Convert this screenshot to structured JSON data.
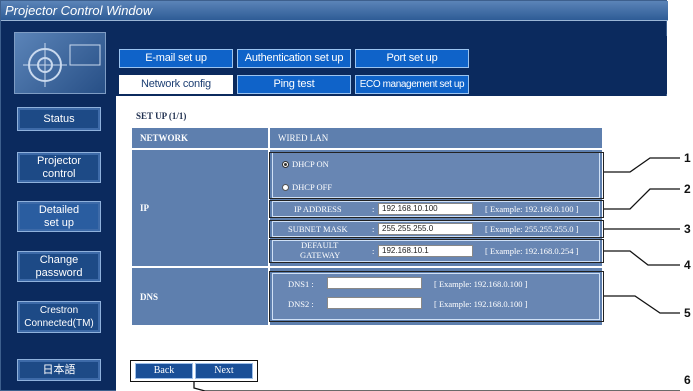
{
  "window": {
    "title": "Projector Control Window"
  },
  "sidebar": {
    "items": [
      {
        "label": "Status"
      },
      {
        "label": "Projector\ncontrol"
      },
      {
        "label": "Detailed\nset up"
      },
      {
        "label": "Change\npassword"
      },
      {
        "label": "Crestron\nConnected(TM)"
      },
      {
        "label": "日本語"
      }
    ]
  },
  "tabs": {
    "row1": [
      "E-mail set up",
      "Authentication set up",
      "Port set up"
    ],
    "row2": [
      "Network config",
      "Ping test",
      "ECO management set up"
    ]
  },
  "page": {
    "setup_title": "SET UP (1/1)"
  },
  "network": {
    "label": "NETWORK",
    "value": "WIRED LAN"
  },
  "ip": {
    "label": "IP",
    "dhcp_on": "DHCP ON",
    "dhcp_off": "DHCP OFF",
    "ip_address_label": "IP ADDRESS",
    "ip_address_value": "192.168.10.100",
    "ip_address_example": "[ Example: 192.168.0.100 ]",
    "subnet_label": "SUBNET MASK",
    "subnet_value": "255.255.255.0",
    "subnet_example": "[ Example: 255.255.255.0 ]",
    "gateway_label_1": "DEFAULT",
    "gateway_label_2": "GATEWAY",
    "gateway_value": "192.168.10.1",
    "gateway_example": "[ Example: 192.168.0.254 ]",
    "separator": ":"
  },
  "dns": {
    "label": "DNS",
    "dns1_label": "DNS1 :",
    "dns1_example": "[ Example: 192.168.0.100 ]",
    "dns2_label": "DNS2 :",
    "dns2_example": "[ Example: 192.168.0.100 ]"
  },
  "nav": {
    "back": "Back",
    "next": "Next"
  },
  "callouts": [
    "1",
    "2",
    "3",
    "4",
    "5",
    "6"
  ]
}
